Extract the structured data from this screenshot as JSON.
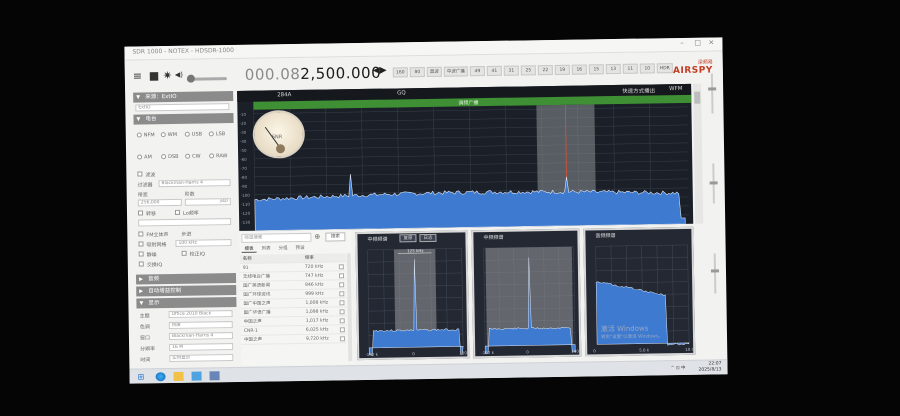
{
  "window": {
    "title": "SDR 1000 - NOTEX - HDSDR-1000",
    "controls": [
      "–",
      "□",
      "×"
    ]
  },
  "toolbar": {
    "menu_icon": "≡",
    "stop_icon": "■",
    "settings_icon": "✷",
    "speaker_icon": "◀)",
    "frequency_dim": "000.08",
    "frequency_main": "2,500.000",
    "freq_arrows": "◀▶",
    "bands": [
      "160",
      "80",
      "直波",
      "中波广播",
      "49",
      "41",
      "31",
      "25",
      "22",
      "19",
      "16",
      "15",
      "13",
      "11",
      "10",
      "HDR"
    ]
  },
  "logo": {
    "cn": "深频易",
    "en": "AIRSPY"
  },
  "left_panel": {
    "source_header": "来源：ExtIO",
    "source_value": "ExtIO",
    "radio_header": "电台",
    "modes_row1": [
      "NFM",
      "WM",
      "USB",
      "LSB"
    ],
    "modes_row2": [
      "AM",
      "DSB",
      "CW",
      "RAW"
    ],
    "filter_label": "滤波",
    "filter_type_label": "过滤器",
    "filter_type_value": "Blackman-Harris 4",
    "bandwidth_label": "带宽",
    "order_label": "阶数",
    "bandwidth_value": "256,000",
    "order_value": "340",
    "shift_label": "转移",
    "lock_label": "Lo频率",
    "fm_label": "FM立体声",
    "step_label": "步进",
    "snap_label": "吸附网格",
    "snap_value": "100 kHz",
    "squelch_label": "静噪",
    "correct_label": "校正IQ",
    "swap_label": "交换IQ",
    "sections": [
      "音频",
      "自动增益控制",
      "显示"
    ],
    "display_rows": [
      {
        "label": "主题",
        "value": "Office 2010 Black"
      },
      {
        "label": "色调",
        "value": "热度"
      },
      {
        "label": "窗口",
        "value": "Blackman-Harris 4"
      },
      {
        "label": "分辨率",
        "value": "16 M"
      },
      {
        "label": "时间",
        "value": "实时显示"
      }
    ]
  },
  "spectrum": {
    "freq_left": "284A",
    "freq_center": "GQ",
    "mode_label": "快速方式播出",
    "mode_value": "WFM",
    "bandplan_label": "调频广播",
    "y_labels": [
      "-10",
      "-20",
      "-30",
      "-40",
      "-50",
      "-60",
      "-70",
      "-80",
      "-90",
      "-100",
      "-110",
      "-120",
      "-130"
    ],
    "smeter_label": "SNR"
  },
  "stations": {
    "search_placeholder": "频道搜索",
    "add_icon": "⊕",
    "search_button": "搜索",
    "tabs": [
      "模板",
      "列表",
      "分组",
      "预设"
    ],
    "columns": [
      "名称",
      "频率"
    ],
    "rows": [
      {
        "name": "91",
        "freq": "720 kHz"
      },
      {
        "name": "无线电台广播",
        "freq": "747 kHz"
      },
      {
        "name": "国广英语新闻",
        "freq": "846 kHz"
      },
      {
        "name": "国广环球资讯",
        "freq": "999 kHz"
      },
      {
        "name": "国广中国之声",
        "freq": "1,008 kHz"
      },
      {
        "name": "国广华语广播",
        "freq": "1,098 kHz"
      },
      {
        "name": "中国之声",
        "freq": "1,017 kHz"
      },
      {
        "name": "CNR-1",
        "freq": "6,025 kHz"
      },
      {
        "name": "中国之声",
        "freq": "9,720 kHz"
      }
    ]
  },
  "panels": {
    "if_title": "中频频谱",
    "if_buttons": [
      "复原",
      "日志"
    ],
    "if_bw_label": "125 kHz",
    "if_x_labels": [
      "-100 k",
      "0",
      "100 k"
    ],
    "audio_title": "中频频谱",
    "audio_x_labels": [
      "-100 k",
      "0",
      "100 k"
    ],
    "af_title": "音频频谱",
    "af_x_labels": [
      "0",
      "5.0 k",
      "10.0 k"
    ]
  },
  "watermark": {
    "line1": "激活 Windows",
    "line2": "转到\"设置\"以激活 Windows。"
  },
  "taskbar": {
    "time": "22:07",
    "date": "2025/8/13",
    "tray": "^ ⊡ 中"
  }
}
